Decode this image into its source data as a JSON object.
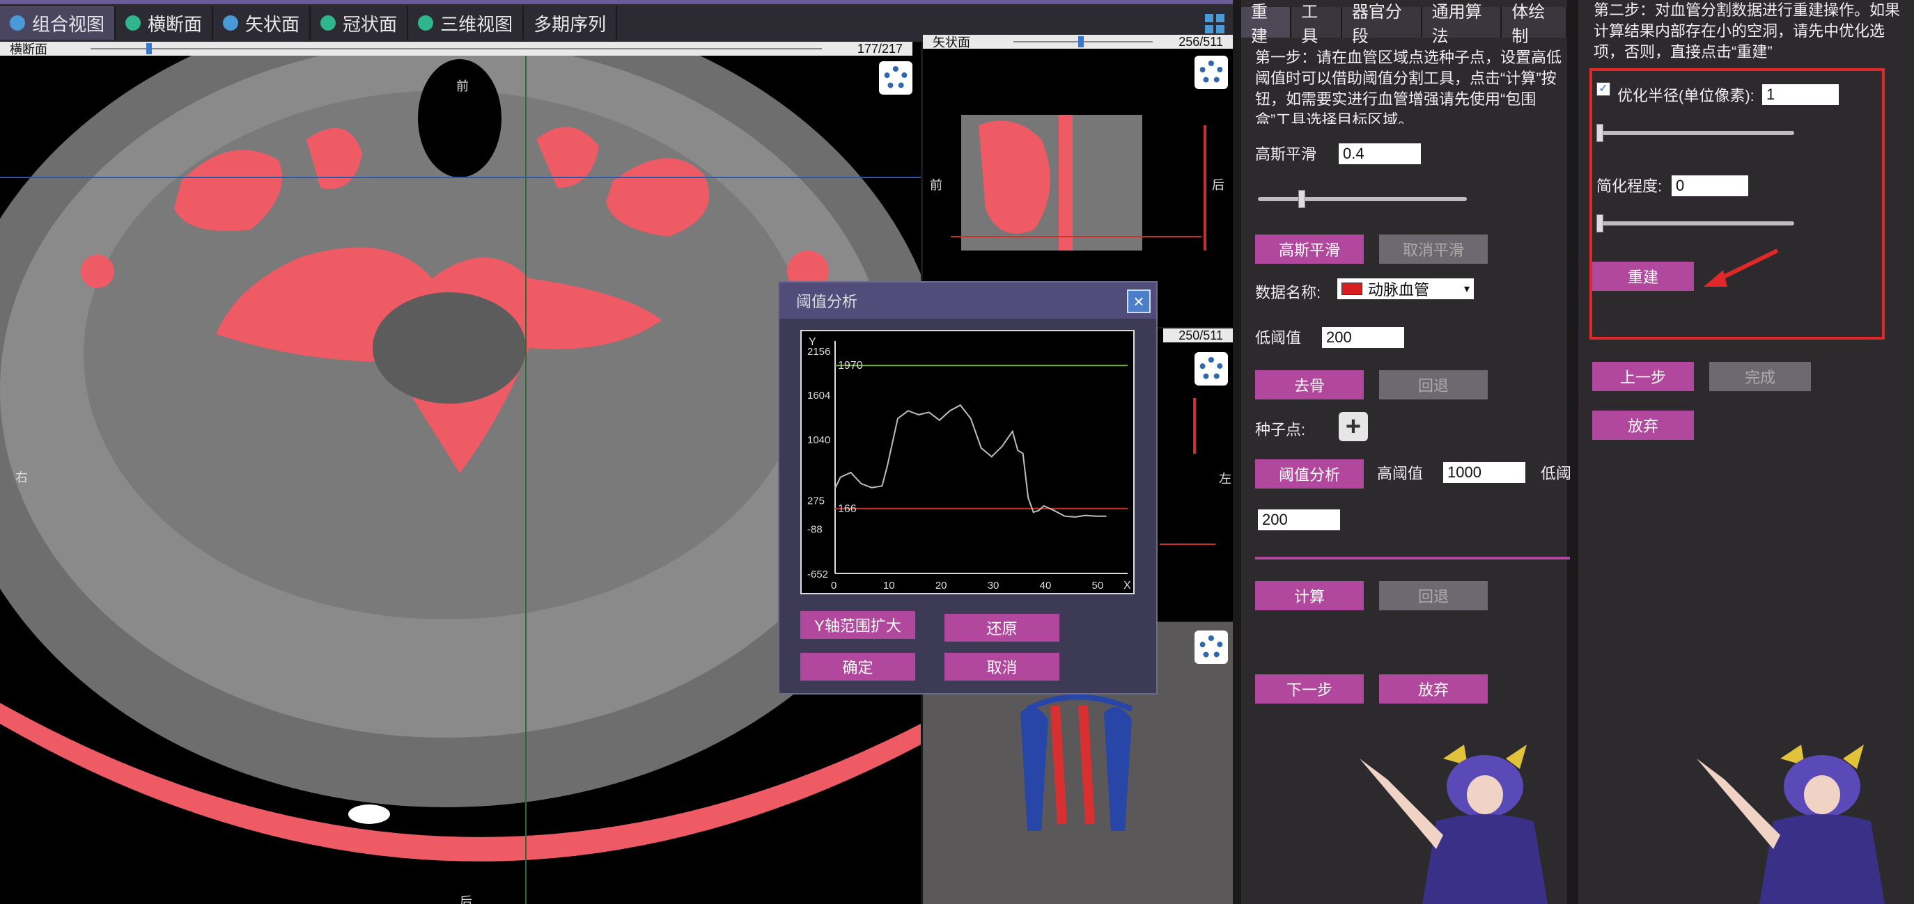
{
  "view_tabs": [
    {
      "label": "组合视图",
      "color": "#4a9ad8"
    },
    {
      "label": "横断面",
      "color": "#2fb58f"
    },
    {
      "label": "矢状面",
      "color": "#4a9ad8"
    },
    {
      "label": "冠状面",
      "color": "#2fb58f"
    },
    {
      "label": "三维视图",
      "color": "#2fb58f"
    },
    {
      "label": "多期序列",
      "color": ""
    }
  ],
  "axial": {
    "name": "横断面",
    "slice": "177/217",
    "orient_top": "前",
    "orient_left": "右",
    "orient_bottom": "后"
  },
  "sagittal": {
    "name": "矢状面",
    "slice": "256/511",
    "orient_left": "前",
    "orient_right": "后"
  },
  "coronal": {
    "slice": "250/511",
    "orient_right": "左"
  },
  "dialog": {
    "title": "阈值分析",
    "y_label": "Y",
    "x_label": "X",
    "y_ticks": [
      "2156",
      "1604",
      "1040",
      "275",
      "-88",
      "-652"
    ],
    "x_ticks": [
      "0",
      "10",
      "20",
      "30",
      "40",
      "50"
    ],
    "upper_line": "1970",
    "lower_line": "166",
    "btn_expand": "Y轴范围扩大",
    "btn_restore": "还原",
    "btn_ok": "确定",
    "btn_cancel": "取消"
  },
  "chart_data": {
    "type": "line",
    "xlabel": "X",
    "ylabel": "Y",
    "ylim": [
      -652,
      2156
    ],
    "xlim": [
      0,
      55
    ],
    "y_ticks": [
      2156,
      1604,
      1040,
      275,
      -88,
      -652
    ],
    "x_ticks": [
      0,
      10,
      20,
      30,
      40,
      50
    ],
    "hlines": [
      {
        "value": 1970,
        "color": "#6fb83a"
      },
      {
        "value": 166,
        "color": "#c8312e"
      }
    ],
    "series": [
      {
        "color": "#bdbdbd",
        "x": [
          0,
          1,
          3,
          5,
          7,
          9,
          10,
          12,
          14,
          16,
          18,
          20,
          22,
          24,
          26,
          28,
          30,
          32,
          34,
          35,
          36,
          37,
          38,
          39,
          40,
          42,
          44,
          46,
          48,
          50,
          52
        ],
        "y": [
          420,
          560,
          620,
          480,
          430,
          450,
          700,
          1300,
          1400,
          1350,
          1380,
          1280,
          1400,
          1470,
          1300,
          930,
          820,
          950,
          1140,
          900,
          860,
          300,
          120,
          140,
          200,
          140,
          70,
          60,
          80,
          70,
          70
        ]
      }
    ]
  },
  "recon": {
    "tabs": [
      "重建",
      "工具",
      "器官分段",
      "通用算法",
      "体绘制"
    ],
    "step1_text": "第一步：请在血管区域点选种子点，设置高低阈值时可以借助阈值分割工具，点击“计算”按钮，如需要实进行血管增强请先使用“包围盒”工具选择目标区域。",
    "gauss_label": "高斯平滑",
    "gauss_value": "0.4",
    "gauss_slider": 0.2,
    "btn_gauss": "高斯平滑",
    "btn_cancel_smooth": "取消平滑",
    "data_name_label": "数据名称:",
    "data_name_value": "动脉血管",
    "data_name_color": "#d81f1f",
    "low_label": "低阈值",
    "low_value": "200",
    "btn_denoise": "去骨",
    "btn_undo1": "回退",
    "seed_label": "种子点:",
    "btn_threshold": "阈值分析",
    "high_label": "高阈值",
    "high_value": "1000",
    "low_label2": "低阈",
    "low_value2": "200",
    "btn_compute": "计算",
    "btn_undo2": "回退",
    "btn_next": "下一步",
    "btn_abandon": "放弃"
  },
  "right_panel": {
    "step2_text": "第二步：对血管分割数据进行重建操作。如果计算结果内部存在小的空洞，请先中优化选项，否则，直接点击“重建”",
    "opt_label": "优化半径(单位像素):",
    "opt_checked": true,
    "opt_value": "1",
    "opt_slider": 0.0,
    "simplify_label": "简化程度:",
    "simplify_value": "0",
    "simplify_slider": 0.0,
    "btn_rebuild": "重建",
    "btn_prev": "上一步",
    "btn_finish": "完成",
    "btn_abandon": "放弃",
    "highlight_color": "#e0282a"
  }
}
